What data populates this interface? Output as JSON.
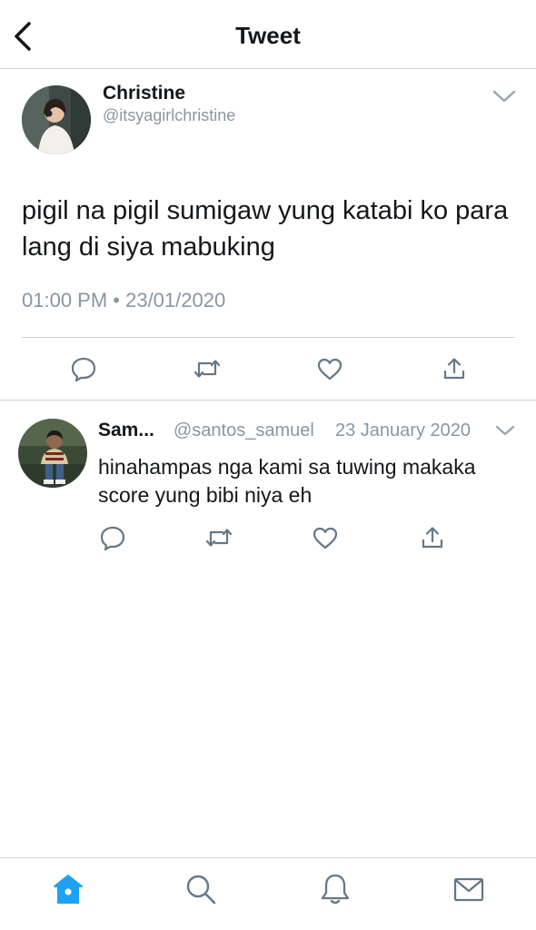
{
  "header": {
    "title": "Tweet",
    "back_icon": "chevron-left-icon"
  },
  "tweet": {
    "name": "Christine",
    "handle": "@itsyagirlchristine",
    "text": "pigil na pigil sumigaw yung katabi ko para lang di siya mabuking",
    "timestamp": "01:00 PM • 23/01/2020",
    "actions": [
      "reply-icon",
      "retweet-icon",
      "like-icon",
      "share-icon"
    ]
  },
  "reply": {
    "name": "Sam...",
    "handle": "@santos_samuel",
    "date": "23 January 2020",
    "text": "hinahampas nga kami sa tuwing makaka score yung bibi niya eh",
    "actions": [
      "reply-icon",
      "retweet-icon",
      "like-icon",
      "share-icon"
    ]
  },
  "tabbar": {
    "items": [
      "home-icon",
      "search-icon",
      "notifications-icon",
      "messages-icon"
    ],
    "active": "home-icon"
  },
  "colors": {
    "accent": "#1da1f2",
    "muted": "#8a96a2",
    "icon": "#657786",
    "divider": "#cfd4d8"
  }
}
